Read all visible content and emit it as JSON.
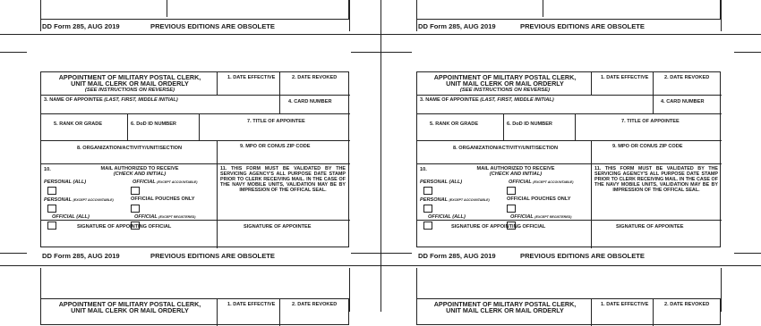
{
  "form": {
    "footer_form": "DD Form 285, AUG 2019",
    "footer_obsolete": "PREVIOUS EDITIONS ARE OBSOLETE",
    "title_line1": "APPOINTMENT OF MILITARY POSTAL CLERK,",
    "title_line2": "UNIT MAIL CLERK OR MAIL ORDERLY",
    "instructions": "(SEE INSTRUCTIONS ON REVERSE)",
    "date_effective": "1. DATE EFFECTIVE",
    "date_revoked": "2. DATE REVOKED",
    "name": "3. NAME OF APPOINTEE",
    "name_format": "(LAST, FIRST, MIDDLE INITIAL)",
    "card_number": "4. CARD NUMBER",
    "rank": "5. RANK OR GRADE",
    "dod_id": "6. DoD ID NUMBER",
    "title_appointee": "7. TITLE OF APPOINTEE",
    "organization": "8. ORGANIZATION/ACTIVITY/UNIT/SECTION",
    "mpo_zip": "9. MPO OR CONUS ZIP CODE",
    "item10_num": "10.",
    "mail_authorized": "MAIL AUTHORIZED TO RECEIVE",
    "check_initial": "(CHECK AND INITIAL)",
    "personal_all": "PERSONAL (ALL)",
    "official_label": "OFFICIAL",
    "except_accountable": "(EXCEPT ACCOUNTABLE)",
    "personal_label": "PERSONAL",
    "official_pouches": "OFFICIAL POUCHES ONLY",
    "official_all": "OFFICIAL (ALL)",
    "except_registered": "(EXCEPT REGISTERED)",
    "note11": "11. THIS FORM MUST BE VALIDATED BY THE SERVICING AGENCY'S ALL PURPOSE DATE STAMP PRIOR TO CLERK RECEIVING MAIL. IN THE CASE OF THE NAVY MOBILE UNITS, VALIDATION MAY BE BY IMPRESSION OF THE OFFICAL SEAL.",
    "sig_official": "SIGNATURE OF APPOINTING OFFICIAL",
    "sig_appointee": "SIGNATURE OF APPOINTEE"
  }
}
